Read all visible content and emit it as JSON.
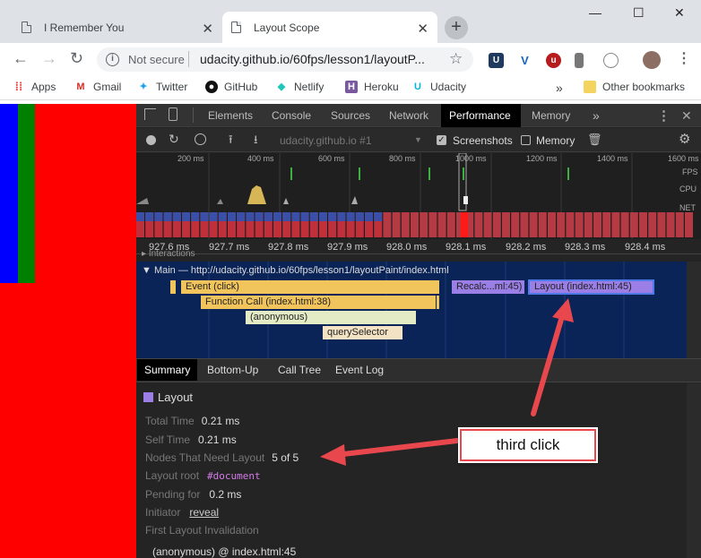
{
  "browser": {
    "tabs": [
      {
        "title": "I Remember You"
      },
      {
        "title": "Layout Scope"
      }
    ],
    "new_tab": "+",
    "omnibox": {
      "security": "Not secure",
      "url": "udacity.github.io/60fps/lesson1/layoutP..."
    },
    "window_controls": {
      "minimize": "—",
      "maximize": "☐",
      "close": "✕"
    }
  },
  "bookmarks": {
    "apps": "Apps",
    "items": [
      "Gmail",
      "Twitter",
      "GitHub",
      "Netlify",
      "Heroku",
      "Udacity"
    ],
    "overflow": "»",
    "other": "Other bookmarks"
  },
  "devtools": {
    "tabs": [
      "Elements",
      "Console",
      "Sources",
      "Network",
      "Performance",
      "Memory"
    ],
    "more": "»",
    "recording_select": "udacity.github.io #1",
    "screenshots_label": "Screenshots",
    "memory_label": "Memory",
    "overview_ticks": [
      "200 ms",
      "400 ms",
      "600 ms",
      "800 ms",
      "1000 ms",
      "1200 ms",
      "1400 ms",
      "1600 ms"
    ],
    "lane_labels": {
      "fps": "FPS",
      "cpu": "CPU",
      "net": "NET"
    },
    "detail_ticks": [
      "927.6 ms",
      "927.7 ms",
      "927.8 ms",
      "927.9 ms",
      "928.0 ms",
      "928.1 ms",
      "928.2 ms",
      "928.3 ms",
      "928.4 ms"
    ],
    "interactions_label": "Interactions",
    "main_label": "Main — http://udacity.github.io/60fps/lesson1/layoutPaint/index.html",
    "flame": {
      "event_click": "Event (click)",
      "function_call": "Function Call (index.html:38)",
      "anonymous": "(anonymous)",
      "query_selector": "querySelector",
      "recalc": "Recalc...ml:45)",
      "layout": "Layout (index.html:45)"
    },
    "summary_tabs": [
      "Summary",
      "Bottom-Up",
      "Call Tree",
      "Event Log"
    ],
    "summary": {
      "title": "Layout",
      "color": "#9b7fe6",
      "rows": [
        {
          "label": "Total Time",
          "value": "0.21 ms"
        },
        {
          "label": "Self Time",
          "value": "0.21 ms"
        },
        {
          "label": "Nodes That Need Layout",
          "value": "5 of 5"
        },
        {
          "label": "Layout root",
          "value": "#document"
        },
        {
          "label": "Pending for",
          "value": "0.2 ms"
        },
        {
          "label": "Initiator",
          "value": "reveal"
        },
        {
          "label": "First Layout Invalidation",
          "value": ""
        }
      ],
      "invalidation": "(anonymous) @ index.html:45"
    }
  },
  "annotation": {
    "callout": "third click"
  },
  "colors": {
    "page_bg": "#ff0000",
    "blue_strip": "#0000ff",
    "green_strip": "#008000",
    "arrow": "#e8484d"
  }
}
